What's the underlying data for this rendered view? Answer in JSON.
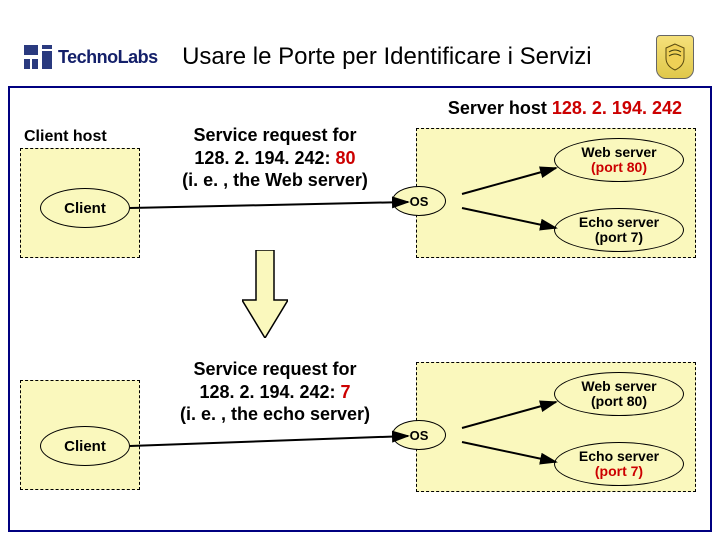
{
  "header": {
    "brand": "TechnoLabs",
    "title": "Usare le Porte per Identificare i Servizi"
  },
  "server_host_label": "Server host ",
  "server_host_ip": "128. 2. 194. 242",
  "client_host_label": "Client host",
  "client_label": "Client",
  "os_label": "OS",
  "web_server": {
    "name": "Web server",
    "port_label": "(port 80)"
  },
  "echo_server": {
    "name": "Echo server",
    "port_label": "(port 7)"
  },
  "request1": {
    "l1": "Service request for",
    "l2_pre": "128. 2. 194. 242:",
    "l2_port": " 80",
    "l3": "(i. e. , the Web server)"
  },
  "request2": {
    "l1": "Service request for",
    "l2_pre": "128. 2. 194. 242:",
    "l2_port": " 7",
    "l3": "(i. e. , the echo server)"
  },
  "chart_data": {
    "type": "diagram",
    "title": "Usare le Porte per Identificare i Servizi",
    "server_host_ip": "128.2.194.242",
    "nodes": [
      {
        "id": "client1",
        "label": "Client",
        "group": "Client host"
      },
      {
        "id": "client2",
        "label": "Client",
        "group": "Client host"
      },
      {
        "id": "os1",
        "label": "OS",
        "group": "Server host 128.2.194.242"
      },
      {
        "id": "os2",
        "label": "OS",
        "group": "Server host 128.2.194.242"
      },
      {
        "id": "web1",
        "label": "Web server (port 80)",
        "group": "Server host 128.2.194.242",
        "port": 80
      },
      {
        "id": "echo1",
        "label": "Echo server (port 7)",
        "group": "Server host 128.2.194.242",
        "port": 7
      },
      {
        "id": "web2",
        "label": "Web server (port 80)",
        "group": "Server host 128.2.194.242",
        "port": 80
      },
      {
        "id": "echo2",
        "label": "Echo server (port 7)",
        "group": "Server host 128.2.194.242",
        "port": 7
      }
    ],
    "edges": [
      {
        "from": "client1",
        "to": "os1",
        "label": "Service request for 128.2.194.242:80 (i.e., the Web server)"
      },
      {
        "from": "os1",
        "to": "web1",
        "highlight": true
      },
      {
        "from": "os1",
        "to": "echo1"
      },
      {
        "from": "client2",
        "to": "os2",
        "label": "Service request for 128.2.194.242:7 (i.e., the echo server)"
      },
      {
        "from": "os2",
        "to": "web2"
      },
      {
        "from": "os2",
        "to": "echo2",
        "highlight": true
      }
    ],
    "time_arrow": {
      "from": "scenario1",
      "to": "scenario2"
    }
  }
}
